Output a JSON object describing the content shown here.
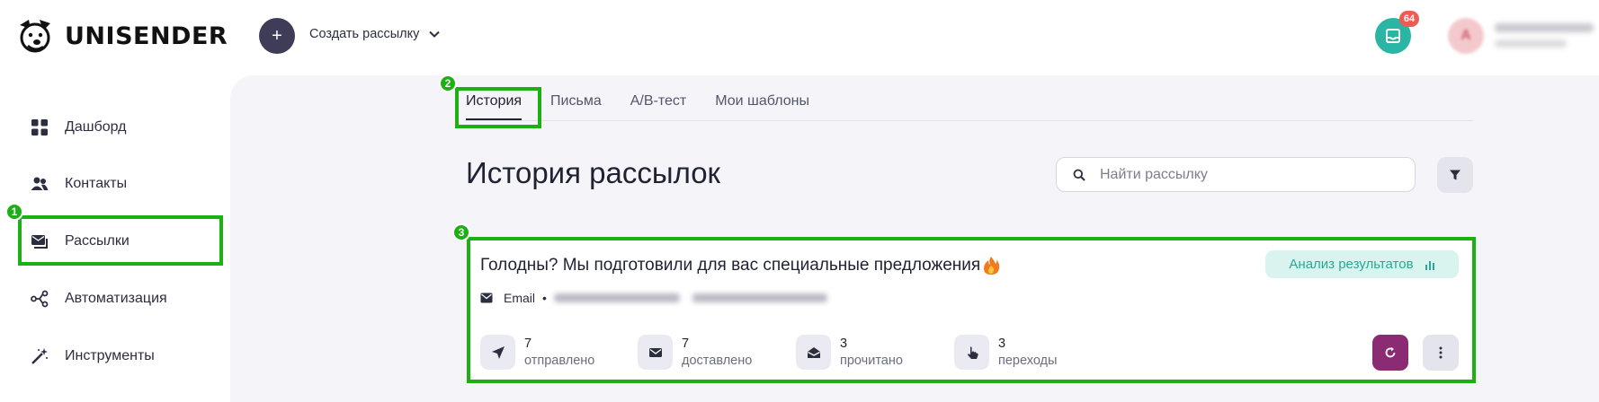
{
  "brand": {
    "name": "UNISENDER"
  },
  "header": {
    "create_label": "Создать рассылку",
    "notifications_count": "64",
    "avatar_letter": "A"
  },
  "sidebar": {
    "items": [
      {
        "label": "Дашборд",
        "icon": "dashboard-grid-icon"
      },
      {
        "label": "Контакты",
        "icon": "users-icon"
      },
      {
        "label": "Рассылки",
        "icon": "mail-stack-icon"
      },
      {
        "label": "Автоматизация",
        "icon": "automation-nodes-icon"
      },
      {
        "label": "Инструменты",
        "icon": "magic-wand-icon"
      }
    ]
  },
  "tabs": [
    {
      "label": "История"
    },
    {
      "label": "Письма"
    },
    {
      "label": "A/B-тест"
    },
    {
      "label": "Мои шаблоны"
    }
  ],
  "page": {
    "title": "История рассылок",
    "search_placeholder": "Найти рассылку"
  },
  "campaign": {
    "title": "Голодны? Мы подготовили для вас специальные предложения",
    "channel": "Email",
    "analysis_label": "Анализ результатов",
    "stats": [
      {
        "value": "7",
        "label": "отправлено",
        "icon": "send-icon"
      },
      {
        "value": "7",
        "label": "доставлено",
        "icon": "envelope-icon"
      },
      {
        "value": "3",
        "label": "прочитано",
        "icon": "open-envelope-icon"
      },
      {
        "value": "3",
        "label": "переходы",
        "icon": "pointer-hand-icon"
      }
    ]
  },
  "annotations": [
    "1",
    "2",
    "3"
  ],
  "colors": {
    "accent_teal": "#2bb5a5",
    "brand_dark": "#3f3c58",
    "refresh_purple": "#8a2b73",
    "highlight_green": "#1cb014",
    "badge_red": "#f05b54"
  }
}
